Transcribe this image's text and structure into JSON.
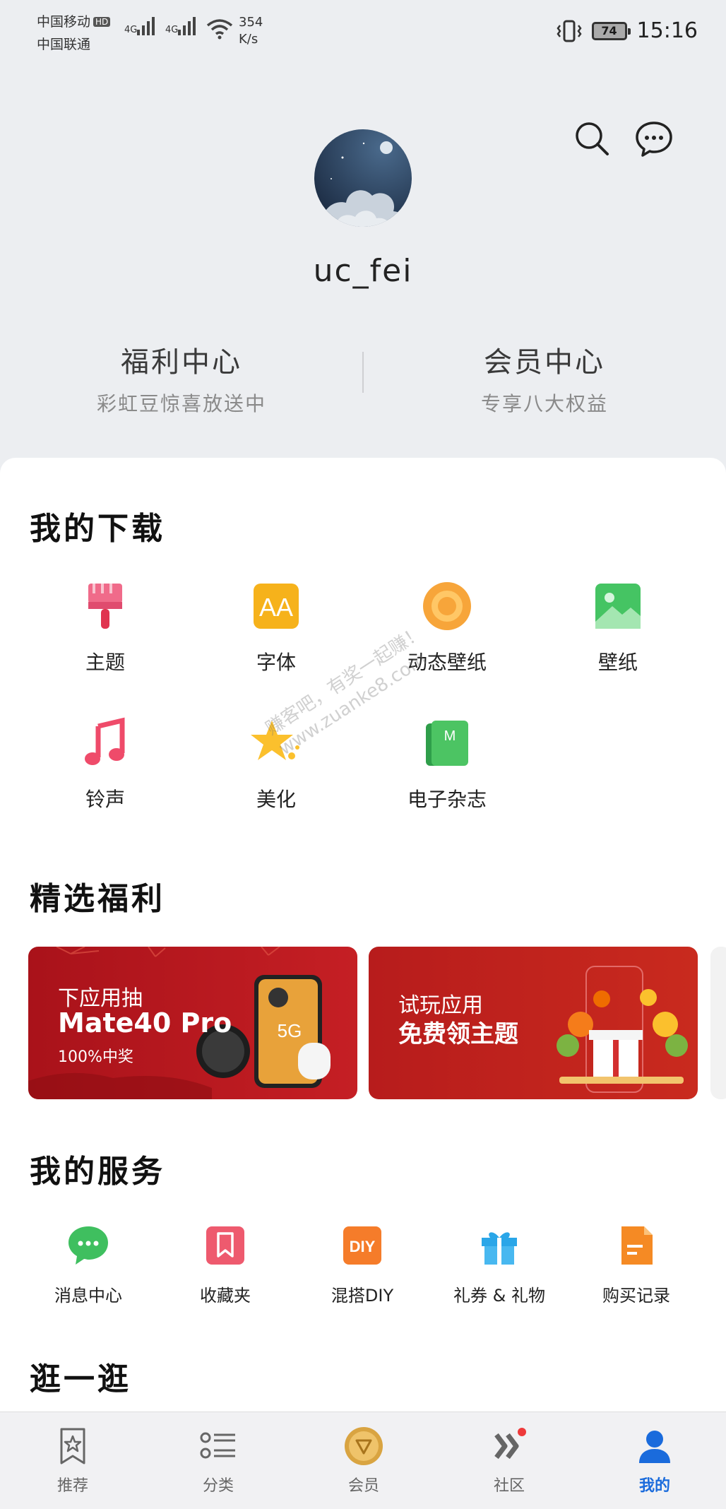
{
  "status_bar": {
    "carrier1": "中国移动",
    "hd": "HD",
    "carrier2": "中国联通",
    "signal1": "4G",
    "signal2": "4G",
    "speed_value": "354",
    "speed_unit": "K/s",
    "battery": "74",
    "time": "15:16"
  },
  "header": {
    "username": "uc_fei",
    "icons": [
      "search-icon",
      "message-icon"
    ]
  },
  "promos": [
    {
      "title": "福利中心",
      "subtitle": "彩虹豆惊喜放送中"
    },
    {
      "title": "会员中心",
      "subtitle": "专享八大权益"
    }
  ],
  "downloads": {
    "title": "我的下载",
    "items": [
      {
        "label": "主题",
        "icon": "brush-icon"
      },
      {
        "label": "字体",
        "icon": "font-icon"
      },
      {
        "label": "动态壁纸",
        "icon": "live-wallpaper-icon"
      },
      {
        "label": "壁纸",
        "icon": "wallpaper-icon"
      },
      {
        "label": "铃声",
        "icon": "music-note-icon"
      },
      {
        "label": "美化",
        "icon": "star-icon"
      },
      {
        "label": "电子杂志",
        "icon": "magazine-icon"
      }
    ]
  },
  "benefits": {
    "title": "精选福利",
    "banners": [
      {
        "line1": "下应用抽",
        "line2": "Mate40 Pro",
        "line3": "100%中奖"
      },
      {
        "line1": "试玩应用",
        "line2": "免费领主题"
      }
    ]
  },
  "services": {
    "title": "我的服务",
    "items": [
      {
        "label": "消息中心",
        "icon": "chat-bubble-icon"
      },
      {
        "label": "收藏夹",
        "icon": "bookmark-icon"
      },
      {
        "label": "混搭DIY",
        "icon": "diy-icon"
      },
      {
        "label": "礼券 & 礼物",
        "icon": "gift-icon"
      },
      {
        "label": "购买记录",
        "icon": "document-icon"
      }
    ]
  },
  "explore": {
    "title": "逛一逛"
  },
  "watermark": "赚客吧，有奖一起赚！ www.zuanke8.com",
  "tabs": [
    {
      "label": "推荐",
      "icon": "star-bookmark-icon"
    },
    {
      "label": "分类",
      "icon": "list-icon"
    },
    {
      "label": "会员",
      "icon": "member-coin-icon"
    },
    {
      "label": "社区",
      "icon": "community-icon"
    },
    {
      "label": "我的",
      "icon": "person-icon",
      "active": true
    }
  ],
  "colors": {
    "accent": "#1a6bdc",
    "banner1": "#b3151d",
    "banner2": "#c2201b"
  }
}
